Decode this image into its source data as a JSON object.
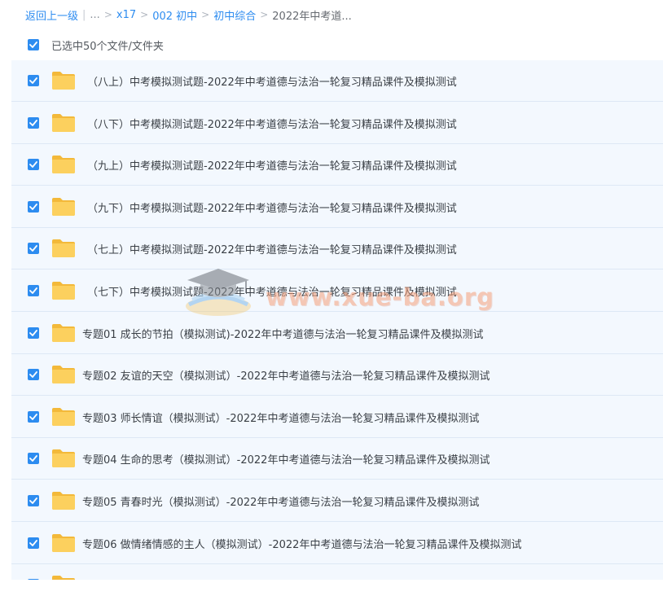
{
  "breadcrumb": {
    "back": "返回上一级",
    "ellipsis": "...",
    "items": [
      "x17",
      "002 初中",
      "初中综合"
    ],
    "current": "2022年中考道..."
  },
  "selection": {
    "label": "已选中50个文件/文件夹",
    "checked": true
  },
  "files": [
    {
      "name": "（八上）中考模拟测试题-2022年中考道德与法治一轮复习精品课件及模拟测试",
      "checked": true,
      "type": "folder"
    },
    {
      "name": "（八下）中考模拟测试题-2022年中考道德与法治一轮复习精品课件及模拟测试",
      "checked": true,
      "type": "folder"
    },
    {
      "name": "（九上）中考模拟测试题-2022年中考道德与法治一轮复习精品课件及模拟测试",
      "checked": true,
      "type": "folder"
    },
    {
      "name": "（九下）中考模拟测试题-2022年中考道德与法治一轮复习精品课件及模拟测试",
      "checked": true,
      "type": "folder"
    },
    {
      "name": "（七上）中考模拟测试题-2022年中考道德与法治一轮复习精品课件及模拟测试",
      "checked": true,
      "type": "folder"
    },
    {
      "name": "（七下）中考模拟测试题-2022年中考道德与法治一轮复习精品课件及模拟测试",
      "checked": true,
      "type": "folder"
    },
    {
      "name": "专题01 成长的节拍（模拟测试)-2022年中考道德与法治一轮复习精品课件及模拟测试",
      "checked": true,
      "type": "folder"
    },
    {
      "name": "专题02 友谊的天空（模拟测试）-2022年中考道德与法治一轮复习精品课件及模拟测试",
      "checked": true,
      "type": "folder"
    },
    {
      "name": "专题03 师长情谊（模拟测试）-2022年中考道德与法治一轮复习精品课件及模拟测试",
      "checked": true,
      "type": "folder"
    },
    {
      "name": "专题04 生命的思考（模拟测试）-2022年中考道德与法治一轮复习精品课件及模拟测试",
      "checked": true,
      "type": "folder"
    },
    {
      "name": "专题05 青春时光（模拟测试）-2022年中考道德与法治一轮复习精品课件及模拟测试",
      "checked": true,
      "type": "folder"
    },
    {
      "name": "专题06 做情绪情感的主人（模拟测试）-2022年中考道德与法治一轮复习精品课件及模拟测试",
      "checked": true,
      "type": "folder"
    },
    {
      "name": "",
      "checked": true,
      "type": "folder"
    }
  ],
  "watermark": {
    "text": "www.xue-ba.org"
  },
  "colors": {
    "accent": "#2d8cf0",
    "row_bg": "#f3f8fe",
    "folder": "#fcd05e",
    "folder_dark": "#f3b93a"
  }
}
